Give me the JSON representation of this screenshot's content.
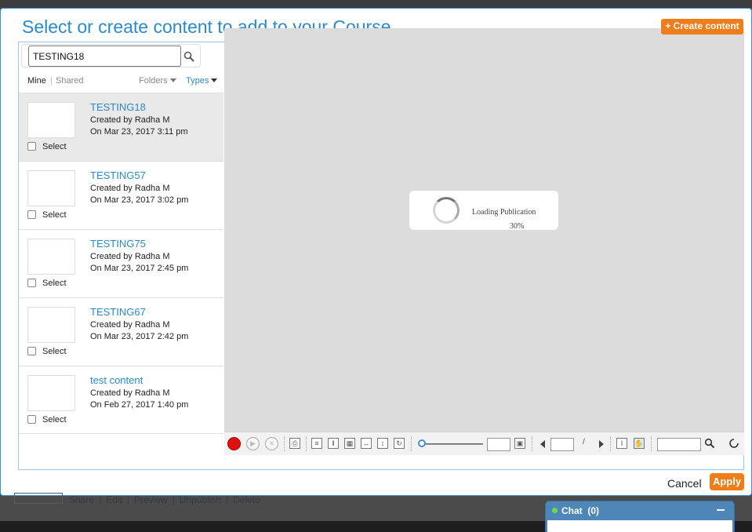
{
  "modal": {
    "title": "Select or create content to add to your Course",
    "create_button": "+ Create content",
    "cancel": "Cancel",
    "apply": "Apply"
  },
  "search": {
    "value": "TESTING18",
    "icon": "magnifier-icon"
  },
  "filters": {
    "mine": "Mine",
    "separator": "|",
    "shared": "Shared",
    "folders": "Folders",
    "types": "Types"
  },
  "items": [
    {
      "title": "TESTING18",
      "created_by": "Created by Radha M",
      "date": "On Mar 23, 2017 3:11 pm",
      "select": "Select"
    },
    {
      "title": "TESTING57",
      "created_by": "Created by Radha M",
      "date": "On Mar 23, 2017 3:02 pm",
      "select": "Select"
    },
    {
      "title": "TESTING75",
      "created_by": "Created by Radha M",
      "date": "On Mar 23, 2017 2:45 pm",
      "select": "Select"
    },
    {
      "title": "TESTING67",
      "created_by": "Created by Radha M",
      "date": "On Mar 23, 2017 2:42 pm",
      "select": "Select"
    },
    {
      "title": "test content",
      "created_by": "Created by Radha M",
      "date": "On Feb 27, 2017 1:40 pm",
      "select": "Select"
    }
  ],
  "viewer": {
    "loading_text": "Loading Publication",
    "loading_percent": "30%",
    "page_separator": "/"
  },
  "background": {
    "links": [
      "Share",
      "|",
      "Edit",
      "|",
      "Preview",
      "|",
      "Unpublish",
      "|",
      "Delete"
    ]
  },
  "chat": {
    "label": "Chat",
    "count": "(0)"
  },
  "colors": {
    "accent": "#2b8acc",
    "orange": "#ef7d1a",
    "chat": "#4f86b8"
  }
}
